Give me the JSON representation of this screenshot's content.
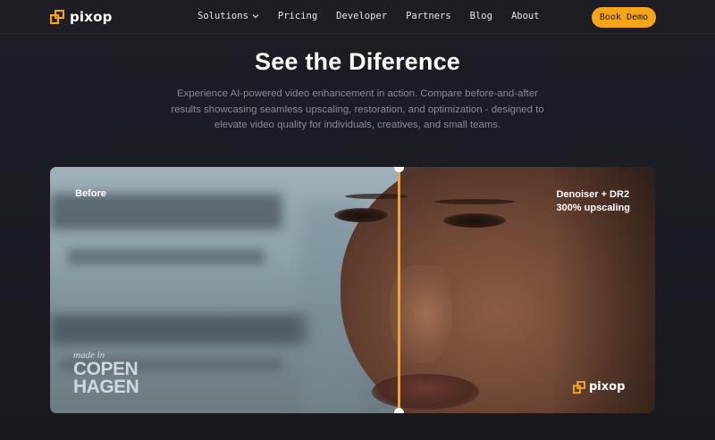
{
  "nav": {
    "logo_text": "pixop",
    "items": [
      {
        "label": "Solutions",
        "has_dropdown": true
      },
      {
        "label": "Pricing"
      },
      {
        "label": "Developer"
      },
      {
        "label": "Partners"
      },
      {
        "label": "Blog"
      },
      {
        "label": "About"
      }
    ],
    "cta_label": "Book Demo"
  },
  "hero": {
    "title": "See the Diference",
    "subtitle": "Experience AI-powered video enhancement in action. Compare before-and-after results showcasing seamless upscaling, restoration, and optimization - designed to elevate video quality for individuals, creatives, and small teams."
  },
  "comparison": {
    "before_label": "Before",
    "after_label_line1": "Denoiser + DR2",
    "after_label_line2": "300% upscaling",
    "watermark_made_in": "made in",
    "watermark_word1": "COPENHAGEN",
    "watermark_line1": "COPEN",
    "watermark_line2": "HAGEN",
    "brand_watermark": "pixop"
  },
  "colors": {
    "accent": "#f5a516",
    "background": "#1c1b22",
    "text_muted": "#8b8a93"
  }
}
